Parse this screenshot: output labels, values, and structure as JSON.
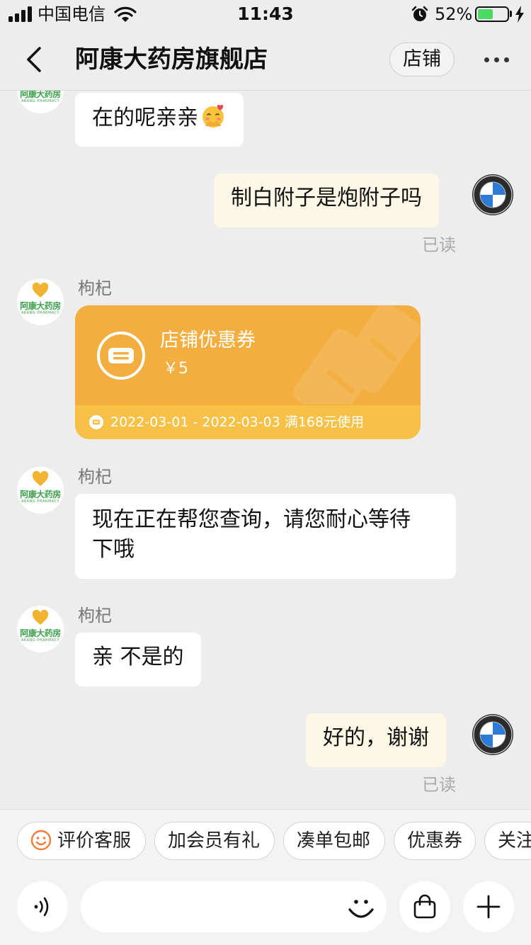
{
  "status_bar": {
    "carrier": "中国电信",
    "time": "11:43",
    "battery_percent": "52%",
    "battery_level": 0.52
  },
  "header": {
    "title": "阿康大药房旗舰店",
    "shop_button": "店铺",
    "more_icon": "more-dots-icon"
  },
  "shop": {
    "logo_text": "阿康大药房",
    "logo_sub": "AKANG PHARMACY"
  },
  "messages": [
    {
      "from": "shop",
      "text": "在的呢亲亲",
      "emoji": "hugging-face-emoji"
    },
    {
      "from": "me",
      "text": "制白附子是炮附子吗",
      "read": "已读"
    },
    {
      "from": "shop",
      "sender": "枸杞",
      "coupon": {
        "title": "店铺优惠券",
        "value": "￥5",
        "validity": "2022-03-01 - 2022-03-03 满168元使用"
      }
    },
    {
      "from": "shop",
      "sender": "枸杞",
      "text_line1": "现在正在帮您查询，请您耐心等待",
      "text_line2": "下哦"
    },
    {
      "from": "shop",
      "sender": "枸杞",
      "text": "亲 不是的"
    },
    {
      "from": "me",
      "text": "好的，谢谢",
      "read": "已读"
    }
  ],
  "quick_replies": [
    "评价客服",
    "加会员有礼",
    "凑单包邮",
    "优惠券",
    "关注"
  ],
  "input": {
    "placeholder": ""
  },
  "colors": {
    "coupon_bg": "#f3ae3f",
    "coupon_footer": "#f7c147",
    "my_bubble": "#fdf8e6",
    "page_bg": "#ededed",
    "smile_accent": "#f07c3a"
  }
}
